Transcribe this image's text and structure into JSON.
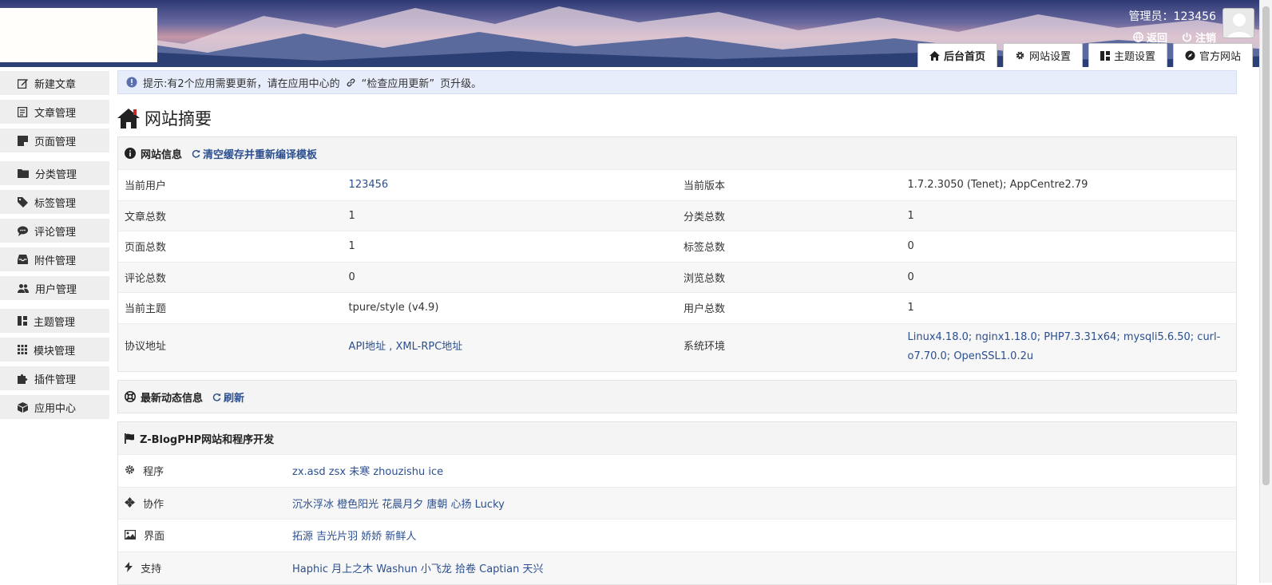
{
  "header": {
    "user_label": "管理员：123456",
    "back_label": "返回",
    "logout_label": "注销"
  },
  "topnav": [
    {
      "label": "后台首页",
      "icon": "home-icon"
    },
    {
      "label": "网站设置",
      "icon": "gear-icon"
    },
    {
      "label": "主题设置",
      "icon": "layout-icon"
    },
    {
      "label": "官方网站",
      "icon": "compass-icon"
    }
  ],
  "sidebar": {
    "items": [
      {
        "label": "新建文章",
        "icon": "edit-icon"
      },
      {
        "label": "文章管理",
        "icon": "article-icon"
      },
      {
        "label": "页面管理",
        "icon": "page-icon"
      },
      {
        "label": "分类管理",
        "icon": "folder-icon"
      },
      {
        "label": "标签管理",
        "icon": "tag-icon"
      },
      {
        "label": "评论管理",
        "icon": "comment-icon"
      },
      {
        "label": "附件管理",
        "icon": "inbox-icon"
      },
      {
        "label": "用户管理",
        "icon": "users-icon"
      },
      {
        "label": "主题管理",
        "icon": "layout-icon"
      },
      {
        "label": "模块管理",
        "icon": "grid-icon"
      },
      {
        "label": "插件管理",
        "icon": "puzzle-icon"
      },
      {
        "label": "应用中心",
        "icon": "box-icon"
      }
    ]
  },
  "notice": {
    "text_before": "提示:有2个应用需要更新，请在应用中心的",
    "link_text": "“检查应用更新”",
    "text_after": "页升级。"
  },
  "page_title": "网站摘要",
  "site_info": {
    "title": "网站信息",
    "action": "清空缓存并重新编译模板",
    "rows": [
      [
        "当前用户",
        "123456",
        "当前版本",
        "1.7.2.3050 (Tenet); AppCentre2.79"
      ],
      [
        "文章总数",
        "1",
        "分类总数",
        "1"
      ],
      [
        "页面总数",
        "1",
        "标签总数",
        "0"
      ],
      [
        "评论总数",
        "0",
        "浏览总数",
        "0"
      ],
      [
        "当前主题",
        "tpure/style (v4.9)",
        "用户总数",
        "1"
      ],
      [
        "协议地址",
        "API地址 , XML-RPC地址",
        "系统环境",
        "Linux4.18.0; nginx1.18.0; PHP7.3.31x64; mysqli5.6.50; curl-o7.70.0; OpenSSL1.0.2u"
      ]
    ]
  },
  "news": {
    "title": "最新动态信息",
    "action": "刷新"
  },
  "dev": {
    "title": "Z-BlogPHP网站和程序开发",
    "rows": [
      {
        "label": "程序",
        "value": "zx.asd zsx 未寒 zhouzishu ice",
        "icon": "settings-icon"
      },
      {
        "label": "协作",
        "value": "沉水浮冰 橙色阳光 花晨月夕 唐朝 心扬 Lucky",
        "icon": "diamond-icon"
      },
      {
        "label": "界面",
        "value": "拓源 吉光片羽 娇娇 新鲜人",
        "icon": "image-icon"
      },
      {
        "label": "支持",
        "value": "Haphic 月上之木 Washun 小飞龙 拾卷 Captian 天兴",
        "icon": "bolt-icon"
      }
    ]
  },
  "colors": {
    "link": "#2b4f8f",
    "notice_bg": "#e8edfb",
    "sidebar_bg": "#eeeeee"
  }
}
